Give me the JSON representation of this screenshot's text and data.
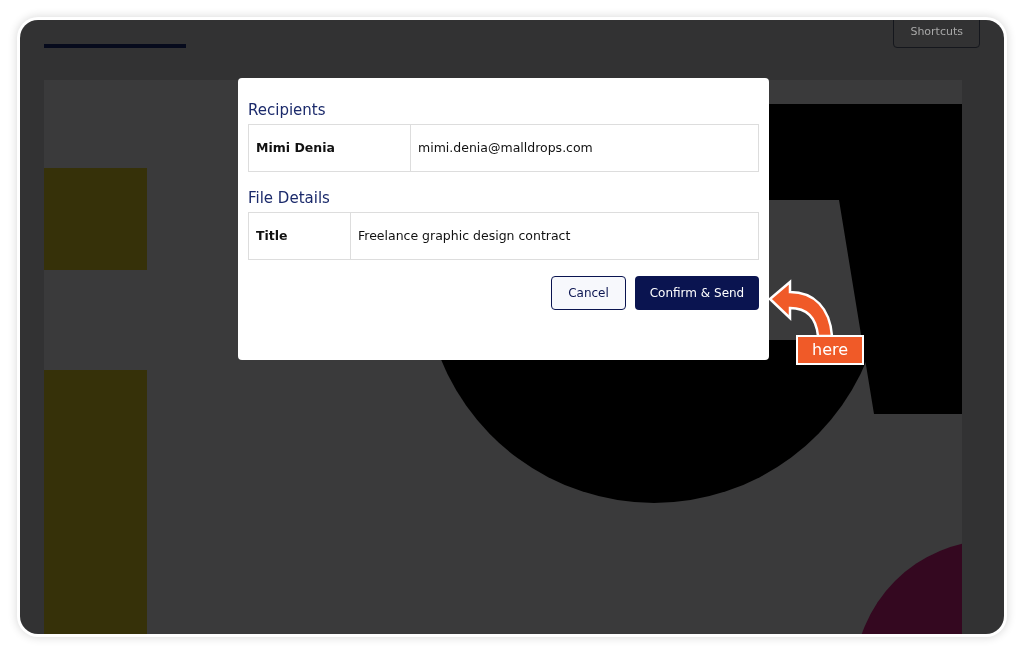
{
  "toolbar": {
    "shortcuts_button": "Shortcuts"
  },
  "dialog": {
    "sections": [
      {
        "heading": "Recipients",
        "rows": [
          {
            "label": "Mimi Denia",
            "value": "mimi.denia@malldrops.com"
          }
        ]
      },
      {
        "heading": "File Details",
        "rows": [
          {
            "label": "Title",
            "value": "Freelance graphic design contract"
          }
        ]
      }
    ],
    "buttons": [
      {
        "label": "Cancel",
        "kind": "secondary"
      },
      {
        "label": "Confirm & Send",
        "kind": "primary"
      }
    ]
  },
  "callout": {
    "label": "here"
  }
}
